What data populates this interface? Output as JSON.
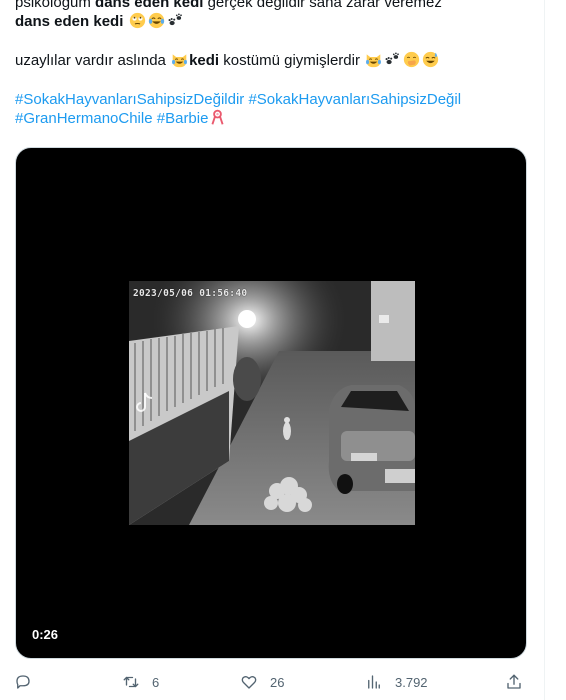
{
  "tweet": {
    "line1": {
      "prefix": "psikoloğum ",
      "bold": "dans eden kedi",
      "suffix": " gerçek değildir sana zarar veremez"
    },
    "line2": {
      "bold": "dans eden kedi"
    },
    "line3": {
      "prefix": "uzaylılar vardır aslında ",
      "bold": "kedi",
      "suffix": " kostümü giymişlerdir"
    },
    "hashtags_line1": [
      "#SokakHayvanlarıSahipsizDeğildir",
      "#SokakHayvanlarıSahipsizDeğil"
    ],
    "hashtags_line2": [
      "#GranHermanoChile",
      "#Barbie"
    ],
    "emojis": {
      "line2": [
        "rolling-eyes-emoji",
        "joy-emoji",
        "paw-prints-emoji"
      ],
      "line3_mid": "joy-cat-emoji",
      "line3_end": [
        "joy-cat-emoji",
        "paw-prints-emoji",
        "hand-over-mouth-emoji",
        "sweat-smile-emoji"
      ],
      "barbie": "pink-ribbon-emoji"
    }
  },
  "media": {
    "cctv_timestamp": "2023/05/06 01:56:40",
    "watermark": "TikTok",
    "duration": "0:26"
  },
  "actions": {
    "reply": {
      "icon": "reply-icon",
      "count": ""
    },
    "retweet": {
      "icon": "retweet-icon",
      "count": "6"
    },
    "like": {
      "icon": "heart-icon",
      "count": "26"
    },
    "views": {
      "icon": "views-icon",
      "count": "3.792"
    },
    "share": {
      "icon": "share-icon"
    }
  },
  "colors": {
    "hashtag": "#1d9bf0",
    "text": "#0f1419",
    "action": "#536471"
  }
}
